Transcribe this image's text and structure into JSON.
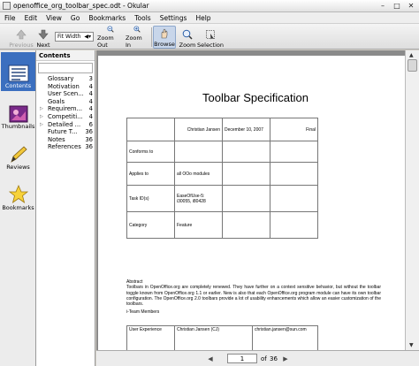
{
  "window": {
    "title": "openoffice_org_toolbar_spec.odt - Okular"
  },
  "menu": [
    "File",
    "Edit",
    "View",
    "Go",
    "Bookmarks",
    "Tools",
    "Settings",
    "Help"
  ],
  "toolbar": {
    "previous": "Previous",
    "next": "Next",
    "zoom_mode": "Fit Width",
    "zoom_out": "Zoom Out",
    "zoom_in": "Zoom In",
    "browse": "Browse",
    "zoom": "Zoom",
    "selection": "Selection"
  },
  "sidebar": {
    "items": [
      {
        "label": "Contents",
        "icon": "contents-icon",
        "active": true
      },
      {
        "label": "Thumbnails",
        "icon": "thumbnails-icon",
        "active": false
      },
      {
        "label": "Reviews",
        "icon": "reviews-icon",
        "active": false
      },
      {
        "label": "Bookmarks",
        "icon": "bookmarks-icon",
        "active": false
      }
    ]
  },
  "contents": {
    "header": "Contents",
    "search_value": "",
    "items": [
      {
        "label": "Glossary",
        "page": "3",
        "expandable": false
      },
      {
        "label": "Motivation",
        "page": "4",
        "expandable": false
      },
      {
        "label": "User Scen...",
        "page": "4",
        "expandable": false
      },
      {
        "label": "Goals",
        "page": "4",
        "expandable": false
      },
      {
        "label": "Requirem...",
        "page": "4",
        "expandable": true
      },
      {
        "label": "Competiti...",
        "page": "4",
        "expandable": true
      },
      {
        "label": "Detailed ...",
        "page": "6",
        "expandable": true
      },
      {
        "label": "Future T...",
        "page": "36",
        "expandable": false
      },
      {
        "label": "Notes",
        "page": "36",
        "expandable": false
      },
      {
        "label": "References",
        "page": "36",
        "expandable": false
      }
    ]
  },
  "document": {
    "title": "Toolbar Specification",
    "table": {
      "r1": [
        "",
        "Christian Jansen",
        "December 10, 2007",
        "Final"
      ],
      "r2_label": "Conforms to",
      "r3_label": "Applies to",
      "r3_value": "all OOo modules",
      "r4_label": "Task ID(s)",
      "r4_value_1": "EaseOfUse-5:",
      "r4_value_2": "i30055, i80428",
      "r5_label": "Category",
      "r5_value": "Feature"
    },
    "abstract_heading": "Abstract",
    "abstract_text": "Toolbars in OpenOffice.org are completely renewed. They have further on a context sensitive behavior, but without the toolbar toggle known from OpenOffice.org 1.1 or earlier. New is also that each OpenOffice.org program module can have its own toolbar configuration. The OpenOffice.org 2.0 toolbars provide a lot of usability enhancements which allow an easier customization of the toolbars.",
    "team_heading": "i-Team Members",
    "team": {
      "role": "User Experience",
      "name": "Christian Jansen (CJ)",
      "email": "christian.jansen@sun.com"
    }
  },
  "status": {
    "current_page": "1",
    "of": "of",
    "total_pages": "36"
  },
  "colors": {
    "accent": "#3b6fbf",
    "viewer_bg": "#8a8a8a"
  }
}
